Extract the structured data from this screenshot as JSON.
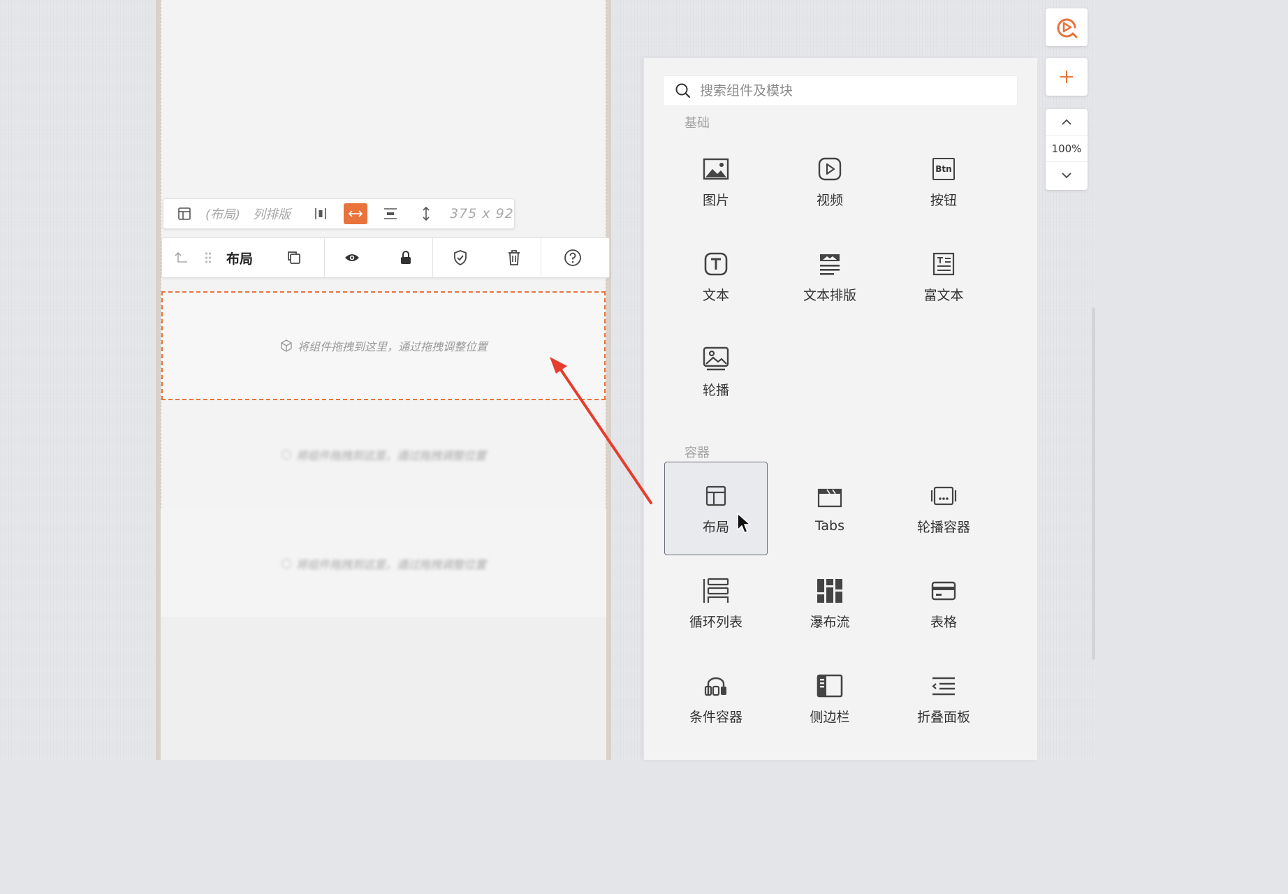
{
  "colors": {
    "accent": "#e8733c",
    "arrow": "#e53d2e",
    "icon": "#454545"
  },
  "layout_toolbar": {
    "layout_icon": "layout-icon",
    "component_name": "(布局)",
    "mode": "列排版",
    "size": "375 x 92"
  },
  "component_toolbar": {
    "name": "布局",
    "icons": [
      "parent-arrow-icon",
      "drag-handle-icon",
      "copy-icon",
      "eye-icon",
      "lock-icon",
      "shield-check-icon",
      "trash-icon",
      "help-icon"
    ]
  },
  "canvas": {
    "drop_hint": "将组件拖拽到这里，通过拖拽调整位置"
  },
  "panel": {
    "search_placeholder": "搜索组件及模块",
    "sections": [
      {
        "title": "基础",
        "items": [
          {
            "label": "图片",
            "icon": "image-icon"
          },
          {
            "label": "视频",
            "icon": "video-icon"
          },
          {
            "label": "按钮",
            "icon": "button-icon",
            "icon_text": "Btn"
          },
          {
            "label": "文本",
            "icon": "text-icon"
          },
          {
            "label": "文本排版",
            "icon": "text-layout-icon"
          },
          {
            "label": "富文本",
            "icon": "rich-text-icon"
          },
          {
            "label": "轮播",
            "icon": "carousel-icon"
          }
        ]
      },
      {
        "title": "容器",
        "items": [
          {
            "label": "布局",
            "icon": "layout-icon",
            "selected": true
          },
          {
            "label": "Tabs",
            "icon": "tabs-icon"
          },
          {
            "label": "轮播容器",
            "icon": "carousel-container-icon"
          },
          {
            "label": "循环列表",
            "icon": "loop-list-icon"
          },
          {
            "label": "瀑布流",
            "icon": "waterfall-icon"
          },
          {
            "label": "表格",
            "icon": "table-icon"
          },
          {
            "label": "条件容器",
            "icon": "condition-container-icon"
          },
          {
            "label": "侧边栏",
            "icon": "sidebar-icon"
          },
          {
            "label": "折叠面板",
            "icon": "collapse-panel-icon"
          }
        ]
      }
    ]
  },
  "side_controls": {
    "zoom": "100%"
  }
}
